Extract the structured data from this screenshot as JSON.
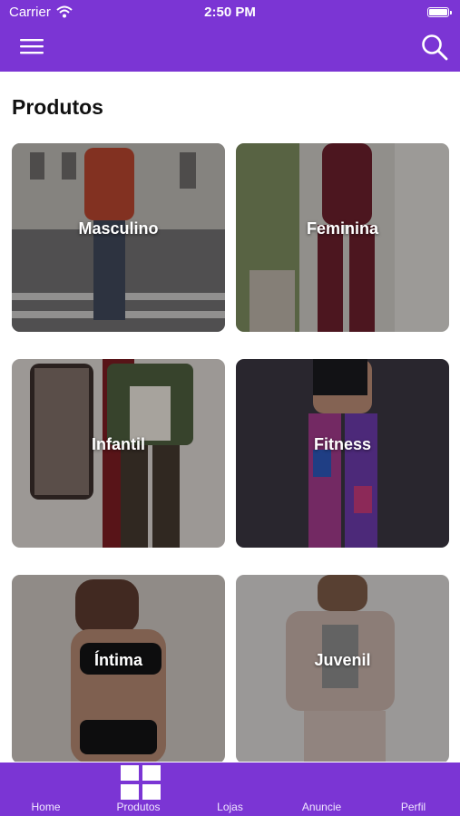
{
  "status_bar": {
    "carrier": "Carrier",
    "time": "2:50 PM"
  },
  "header": {
    "menu_icon": "hamburger-menu-icon",
    "search_icon": "search-icon",
    "background": "#7b35d4"
  },
  "page": {
    "title": "Produtos"
  },
  "categories": [
    {
      "label": "Masculino"
    },
    {
      "label": "Feminina"
    },
    {
      "label": "Infantil"
    },
    {
      "label": "Fitness"
    },
    {
      "label": "Íntima"
    },
    {
      "label": "Juvenil"
    }
  ],
  "tabbar": {
    "active": "Produtos",
    "tabs": [
      {
        "label": "Home"
      },
      {
        "label": "Produtos",
        "icon": "grid-icon"
      },
      {
        "label": "Lojas"
      },
      {
        "label": "Anuncie"
      },
      {
        "label": "Perfil"
      }
    ]
  }
}
